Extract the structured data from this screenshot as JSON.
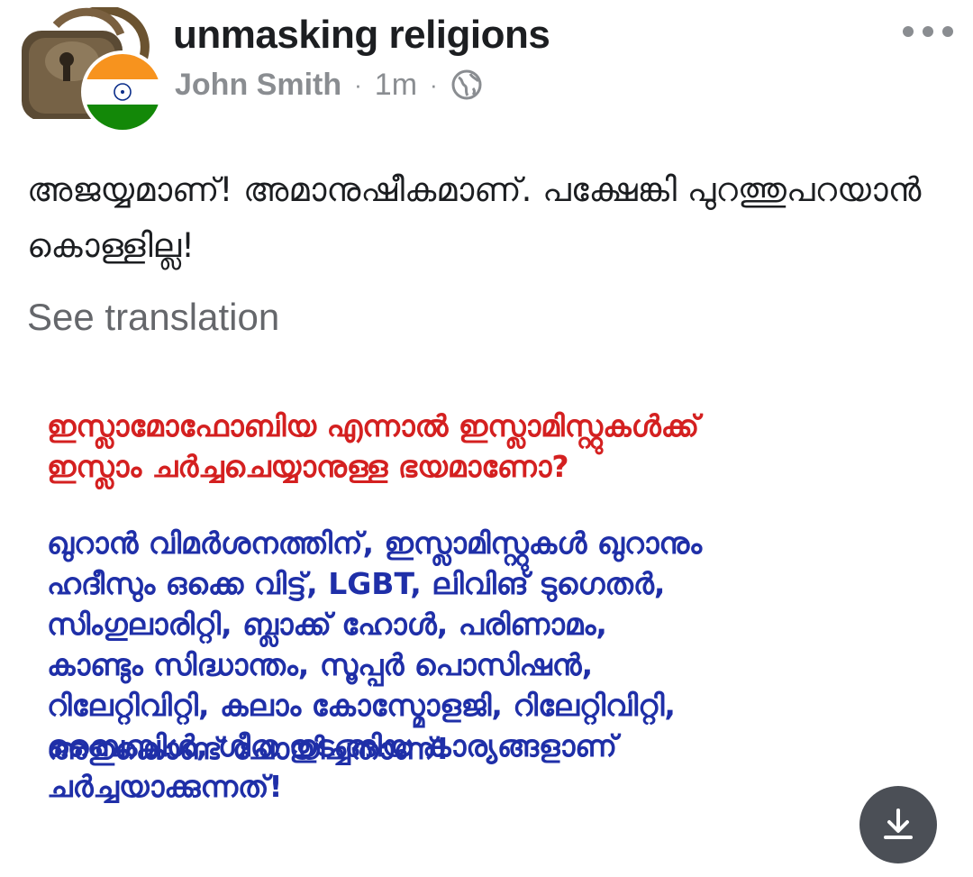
{
  "post": {
    "group_name": "unmasking religions",
    "author": "John Smith",
    "separator": "·",
    "time": "1m",
    "text": "അജയ്യമാണ്! അമാനുഷീകമാണ്. പക്ഷേങ്കി പുറത്തുപറയാൻ കൊള്ളില്ല!",
    "see_translation": "See translation",
    "privacy_icon": "globe-icon",
    "more_icon": "more-horizontal-icon"
  },
  "image": {
    "heading": "ഇസ്ലാമോഫോബിയ എന്നാൽ ഇസ്ലാമിസ്റ്റുകൾക്ക്\nഇസ്ലാം ചർച്ചചെയ്യാനുള്ള ഭയമാണോ?",
    "body": "ഖുറാൻ വിമർശനത്തിന്, ഇസ്ലാമിസ്റ്റുകൾ ഖുറാനും\nഹദീസും ഒക്കെ വിട്ട്, LGBT, ലിവിങ് ടുഗെതർ,\nസിംഗുലാരിറ്റി, ബ്ലാക്ക് ഹോൾ, പരിണാമം,\nകാണ്ടും സിദ്ധാന്തം, സൂപ്പർ പൊസിഷൻ,\nറിലേറ്റിവിറ്റി, കലാം കോസ്മോളജി, റിലേറ്റിവിറ്റി,\nബൈബിൾ, ഗീത  തുടങ്ങിയ കാര്യങ്ങളാണ്\nചർച്ചയാക്കുന്നത്!",
    "closing": "അതുകൊണ്ട് ചോയിച്ചതാണ്!",
    "heading_color": "#d42020",
    "body_color": "#1f2fa8"
  },
  "actions": {
    "download_icon": "download-icon"
  }
}
